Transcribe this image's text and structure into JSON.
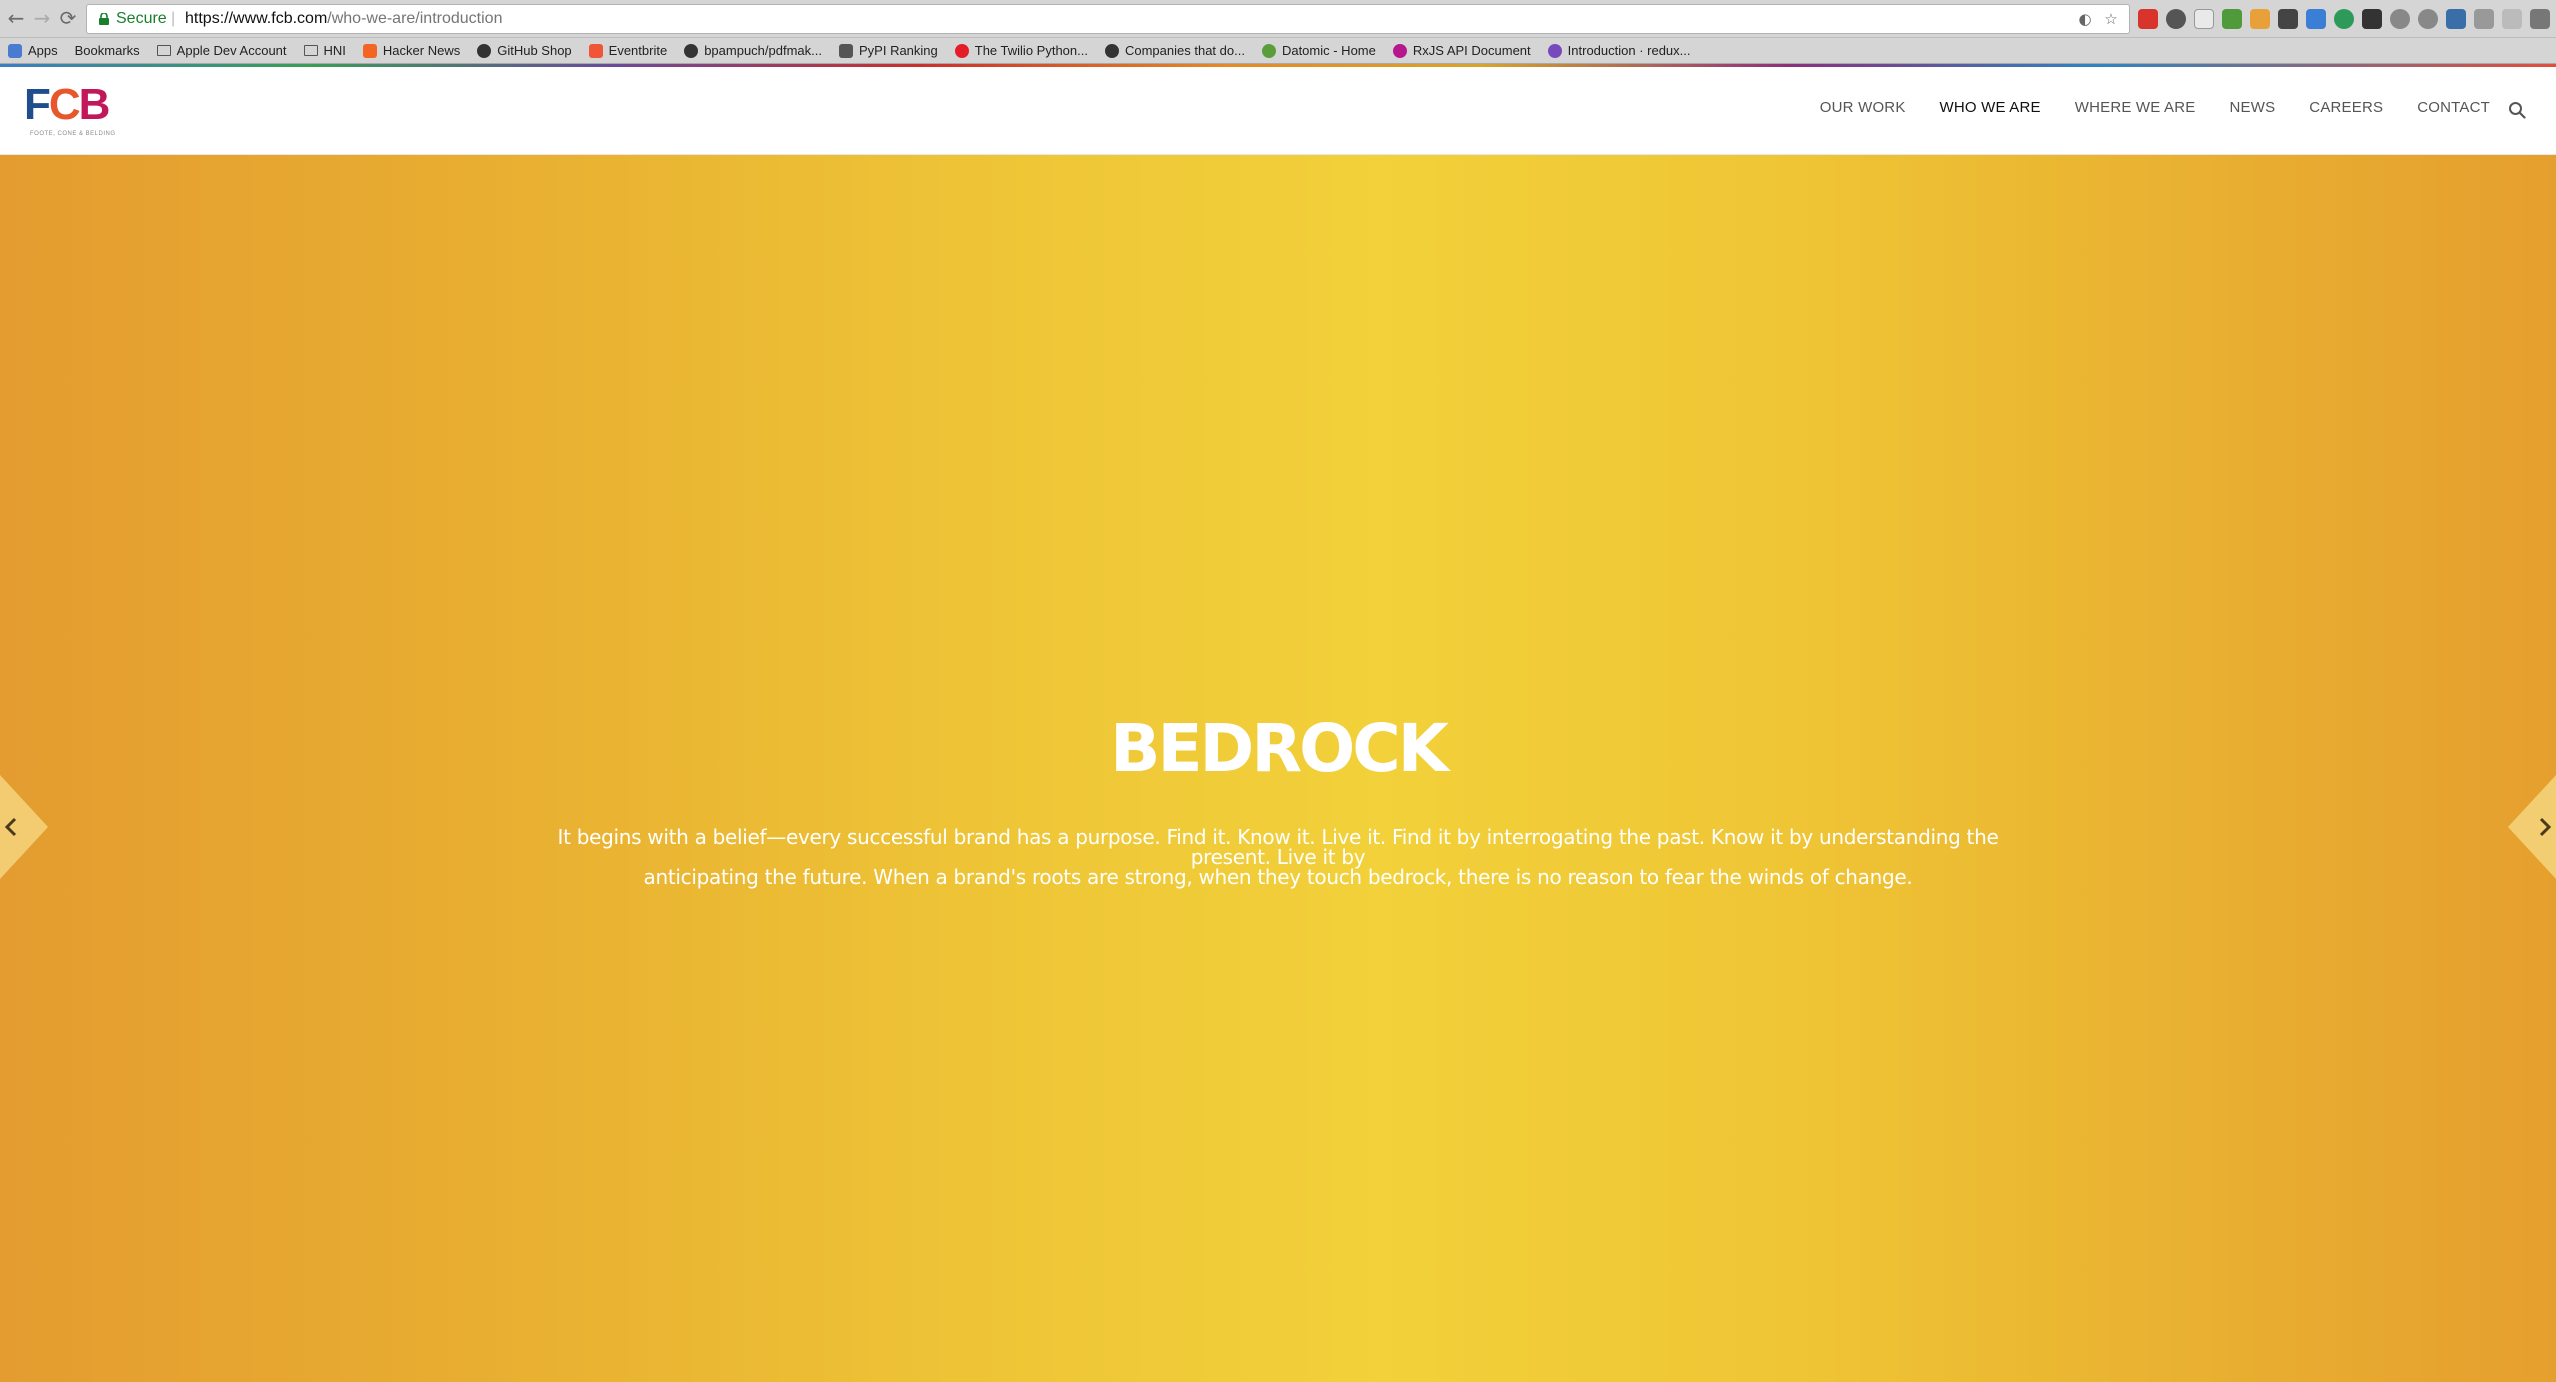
{
  "browser": {
    "secure_label": "Secure",
    "url_host": "https://www.fcb.com",
    "url_path": "/who-we-are/introduction",
    "bookmarks": [
      {
        "label": "Apps",
        "color": "#4a7bd0"
      },
      {
        "label": "Bookmarks",
        "color": "#777777"
      },
      {
        "label": "Apple Dev Account",
        "color": "#777777"
      },
      {
        "label": "HNI",
        "color": "#777777"
      },
      {
        "label": "Hacker News",
        "color": "#f26522"
      },
      {
        "label": "GitHub Shop",
        "color": "#333333"
      },
      {
        "label": "Eventbrite",
        "color": "#f05537"
      },
      {
        "label": "bpampuch/pdfmak...",
        "color": "#333333"
      },
      {
        "label": "PyPI Ranking",
        "color": "#555555"
      },
      {
        "label": "The Twilio Python...",
        "color": "#e31e26"
      },
      {
        "label": "Companies that do...",
        "color": "#333333"
      },
      {
        "label": "Datomic - Home",
        "color": "#5a9e3a"
      },
      {
        "label": "RxJS API Document",
        "color": "#b7178c"
      },
      {
        "label": "Introduction · redux...",
        "color": "#764abc"
      }
    ]
  },
  "site": {
    "logo_text_f": "F",
    "logo_text_c": "C",
    "logo_text_b": "B",
    "logo_tagline": "FOOTE, CONE & BELDING",
    "nav": [
      {
        "label": "OUR WORK",
        "active": false
      },
      {
        "label": "WHO WE ARE",
        "active": true
      },
      {
        "label": "WHERE WE ARE",
        "active": false
      },
      {
        "label": "NEWS",
        "active": false
      },
      {
        "label": "CAREERS",
        "active": false
      },
      {
        "label": "CONTACT",
        "active": false
      }
    ]
  },
  "hero": {
    "title": "BEDROCK",
    "body_line1": "It begins with a belief—every successful brand has a purpose. Find it. Know it. Live it. Find it by interrogating the past. Know it by understanding the present. Live it by",
    "body_line2": "anticipating the future. When a brand's roots are strong, when they touch bedrock, there is no reason to fear the winds of change."
  },
  "colors": {
    "hero_gradient_edge": "#e49c30",
    "hero_gradient_center": "#f2d13a",
    "secure_green": "#1a7f2c"
  }
}
